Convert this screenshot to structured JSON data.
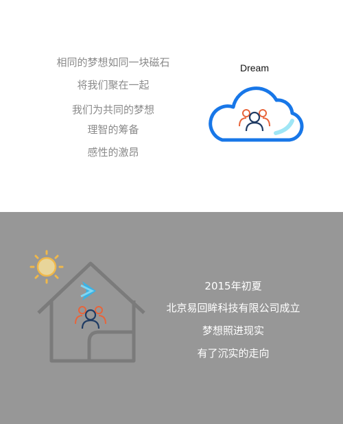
{
  "top_section": {
    "lines": [
      "相同的梦想如同一块磁石",
      "将我们聚在一起",
      "我们为共同的梦想",
      "理智的筹备",
      "感性的激昂"
    ],
    "dream_label": "Dream",
    "icons": [
      "cloud-icon",
      "people-icon"
    ]
  },
  "bottom_section": {
    "lines": [
      "2015年初夏",
      "北京易回眸科技有限公司成立",
      "梦想照进现实",
      "有了沉实的走向"
    ],
    "icons": [
      "sun-icon",
      "house-icon",
      "arrow-icon",
      "people-icon"
    ]
  },
  "colors": {
    "top_background": "#ffffff",
    "bottom_background": "#979797",
    "top_text": "#8a8a8a",
    "bottom_text": "#ffffff",
    "cloud_blue": "#1877e8",
    "people_orange": "#e8643a",
    "people_navy": "#1f3b63",
    "sun_yellow": "#f0b84a",
    "house_gray": "#7b7b7b"
  }
}
